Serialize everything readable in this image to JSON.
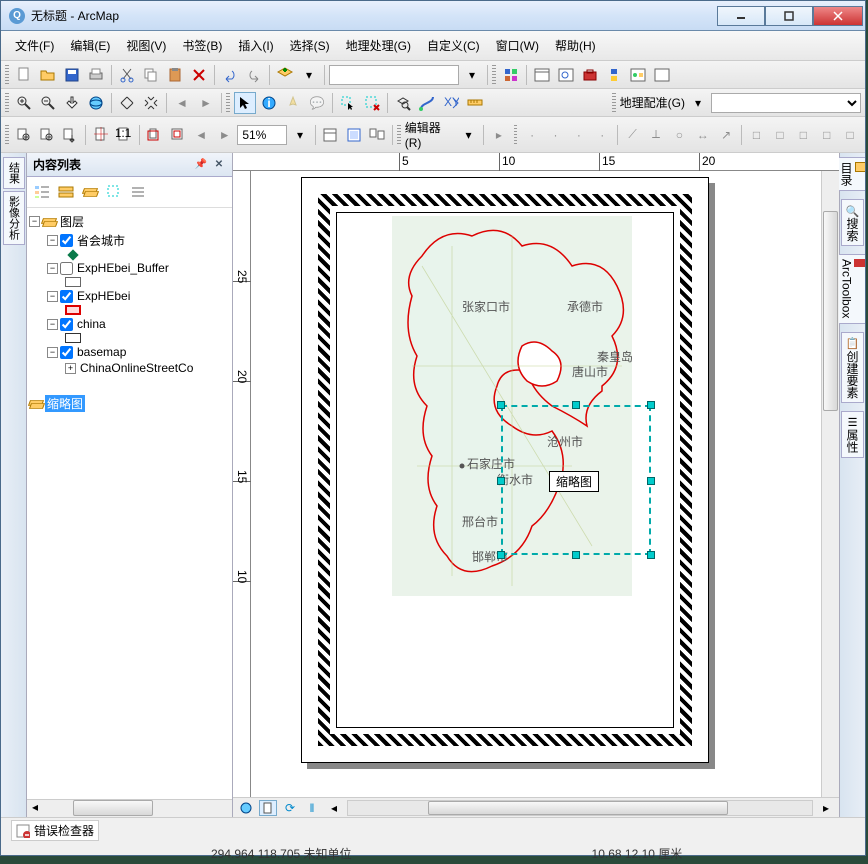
{
  "window": {
    "title": "无标题 - ArcMap"
  },
  "menu": {
    "file": "文件(F)",
    "edit": "编辑(E)",
    "view": "视图(V)",
    "bookmarks": "书签(B)",
    "insert": "插入(I)",
    "selection": "选择(S)",
    "geoprocessing": "地理处理(G)",
    "customize": "自定义(C)",
    "windows": "窗口(W)",
    "help": "帮助(H)"
  },
  "toolbar": {
    "zoom": "51%",
    "editor": "编辑器(R)",
    "georef": "地理配准(G)"
  },
  "toc": {
    "title": "内容列表",
    "root": "图层",
    "layers": [
      {
        "name": "省会城市",
        "checked": true
      },
      {
        "name": "ExpHEbei_Buffer",
        "checked": false
      },
      {
        "name": "ExpHEbei",
        "checked": true
      },
      {
        "name": "china",
        "checked": true
      },
      {
        "name": "basemap",
        "checked": true
      },
      {
        "name": "ChinaOnlineStreetCo"
      }
    ],
    "overview": "缩略图"
  },
  "sidetabs": {
    "results": "结果",
    "imagery": "影像分析",
    "catalog": "目录",
    "search": "搜索",
    "toolbox": "ArcToolbox",
    "create": "创建要素",
    "attrs": "属性"
  },
  "layout": {
    "ruler_h": [
      "5",
      "10",
      "15",
      "20"
    ],
    "ruler_v": [
      "25",
      "20",
      "15",
      "10"
    ],
    "selection_label": "缩略图",
    "map_labels": [
      "张家口市",
      "承德市",
      "秦皇岛市",
      "唐山市",
      "石家庄市",
      "衡水市",
      "沧州市",
      "邢台市",
      "邯郸市"
    ]
  },
  "status": {
    "error_checker": "错误检查器",
    "coords": "294.964  118.705 未知单位",
    "page_coords": "10.68  12.10 厘米"
  }
}
